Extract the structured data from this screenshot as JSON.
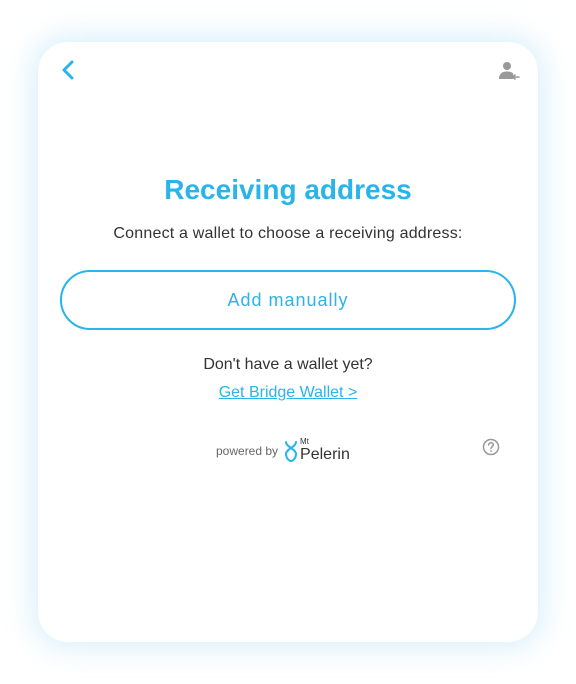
{
  "header": {
    "back_icon": "chevron-left-icon",
    "account_icon": "user-icon"
  },
  "main": {
    "title": "Receiving address",
    "subtitle": "Connect a wallet to choose a receiving address:",
    "add_manually_label": "Add manually",
    "no_wallet_text": "Don't have a wallet yet?",
    "get_wallet_link": "Get Bridge Wallet >"
  },
  "footer": {
    "powered_by": "powered by",
    "brand_small": "Mt",
    "brand_name": "Pelerin",
    "help_icon": "question-circle-icon"
  },
  "colors": {
    "accent": "#29b4ea",
    "text": "#333333",
    "muted": "#999999"
  }
}
